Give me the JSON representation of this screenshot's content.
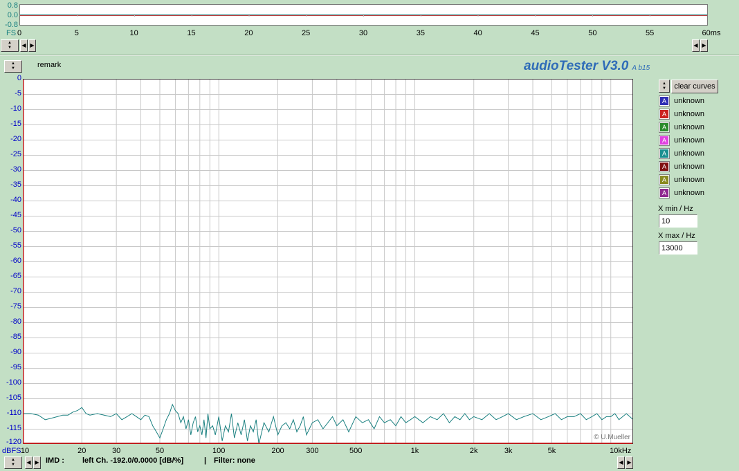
{
  "scope": {
    "y_labels": [
      "0.8",
      "0.0",
      "-0.8"
    ],
    "fs_label": "FS",
    "x_ticks": [
      "0",
      "5",
      "10",
      "15",
      "20",
      "25",
      "30",
      "35",
      "40",
      "45",
      "50",
      "55",
      "60ms"
    ]
  },
  "header": {
    "remark_label": "remark",
    "app_title": "audioTester V3.0",
    "app_build": "A b15"
  },
  "legend": {
    "clear_button": "clear curves",
    "swatch_glyph": "A",
    "items": [
      {
        "label": "unknown",
        "color": "#2f2fb5"
      },
      {
        "label": "unknown",
        "color": "#cc2020"
      },
      {
        "label": "unknown",
        "color": "#2a8a2a"
      },
      {
        "label": "unknown",
        "color": "#e040e0"
      },
      {
        "label": "unknown",
        "color": "#1a9090"
      },
      {
        "label": "unknown",
        "color": "#801010"
      },
      {
        "label": "unknown",
        "color": "#8a8a20"
      },
      {
        "label": "unknown",
        "color": "#902890"
      }
    ],
    "xmin_label": "X min / Hz",
    "xmin_value": "10",
    "xmax_label": "X max / Hz",
    "xmax_value": "13000"
  },
  "chart_data": {
    "type": "line",
    "y_unit": "dBFS",
    "x_unit_label": "10kHz",
    "x_scale": "log",
    "xlim": [
      10,
      13000
    ],
    "ylim": [
      -120,
      0
    ],
    "y_ticks": [
      0,
      -5,
      -10,
      -15,
      -20,
      -25,
      -30,
      -35,
      -40,
      -45,
      -50,
      -55,
      -60,
      -65,
      -70,
      -75,
      -80,
      -85,
      -90,
      -95,
      -100,
      -105,
      -110,
      -115,
      -120
    ],
    "x_ticks": [
      {
        "v": 10,
        "label": "10"
      },
      {
        "v": 20,
        "label": "20"
      },
      {
        "v": 30,
        "label": "30"
      },
      {
        "v": 50,
        "label": "50"
      },
      {
        "v": 100,
        "label": "100"
      },
      {
        "v": 200,
        "label": "200"
      },
      {
        "v": 300,
        "label": "300"
      },
      {
        "v": 500,
        "label": "500"
      },
      {
        "v": 1000,
        "label": "1k"
      },
      {
        "v": 2000,
        "label": "2k"
      },
      {
        "v": 3000,
        "label": "3k"
      },
      {
        "v": 5000,
        "label": "5k"
      },
      {
        "v": 10000,
        "label": "10kHz"
      }
    ],
    "grid": true,
    "line_color": "#1a8080",
    "watermark": "© U.Mueller",
    "series": [
      {
        "color": "#1a8080",
        "x": [
          10,
          10.3,
          11,
          12,
          13,
          14,
          15,
          16,
          17,
          18,
          19,
          20,
          21,
          22,
          24,
          26,
          28,
          30,
          32,
          34,
          36,
          38,
          40,
          42,
          44,
          46,
          48,
          50,
          52,
          54,
          56,
          58,
          60,
          62,
          64,
          66,
          68,
          70,
          72,
          74,
          76,
          78,
          80,
          82,
          84,
          86,
          88,
          90,
          93,
          96,
          100,
          104,
          108,
          112,
          116,
          120,
          125,
          130,
          135,
          140,
          145,
          150,
          155,
          160,
          170,
          180,
          190,
          200,
          210,
          220,
          230,
          240,
          250,
          260,
          270,
          280,
          300,
          320,
          340,
          360,
          380,
          400,
          430,
          460,
          500,
          540,
          580,
          620,
          660,
          700,
          750,
          800,
          850,
          900,
          950,
          1000,
          1100,
          1200,
          1300,
          1400,
          1500,
          1600,
          1700,
          1800,
          1900,
          2000,
          2200,
          2400,
          2600,
          2800,
          3000,
          3300,
          3600,
          4000,
          4400,
          4800,
          5200,
          5600,
          6000,
          6500,
          7000,
          7500,
          8000,
          8500,
          9000,
          9500,
          10000,
          10500,
          11000,
          11500,
          12000,
          12500,
          13000
        ],
        "y": [
          -110,
          -110,
          -110,
          -110.5,
          -112,
          -111.5,
          -111,
          -110.5,
          -110.5,
          -109.5,
          -109,
          -108,
          -110,
          -110.5,
          -110,
          -110.5,
          -111,
          -110,
          -112,
          -111,
          -110,
          -111,
          -112,
          -110.5,
          -111,
          -114,
          -116,
          -118,
          -115,
          -112,
          -110,
          -107,
          -109,
          -110,
          -113,
          -111,
          -115,
          -112,
          -117,
          -113,
          -111,
          -116,
          -114,
          -117,
          -112,
          -118,
          -110,
          -115,
          -114,
          -117,
          -111,
          -119,
          -114,
          -116,
          -110,
          -118,
          -113,
          -117,
          -112,
          -119,
          -114,
          -116,
          -112,
          -120,
          -113,
          -116,
          -111,
          -117,
          -114,
          -113,
          -115,
          -112,
          -116,
          -114,
          -111,
          -117,
          -113,
          -112,
          -115,
          -113,
          -111,
          -114,
          -112,
          -116,
          -111,
          -113,
          -112,
          -115,
          -111,
          -113,
          -112,
          -114,
          -111,
          -113,
          -112,
          -111,
          -113,
          -111,
          -112,
          -110,
          -113,
          -111,
          -112,
          -110,
          -112,
          -111,
          -112,
          -110,
          -112,
          -111,
          -110,
          -112,
          -111,
          -110,
          -112,
          -111,
          -110,
          -112,
          -111,
          -111,
          -110,
          -112,
          -111,
          -110,
          -112,
          -111,
          -111,
          -110,
          -112,
          -111,
          -110,
          -111,
          -112
        ]
      }
    ]
  },
  "status": {
    "mode": "IMD :",
    "channel_text": "left Ch. -192.0/0.0000 [dB/%]",
    "separator": "|",
    "filter_text": "Filter: none"
  }
}
